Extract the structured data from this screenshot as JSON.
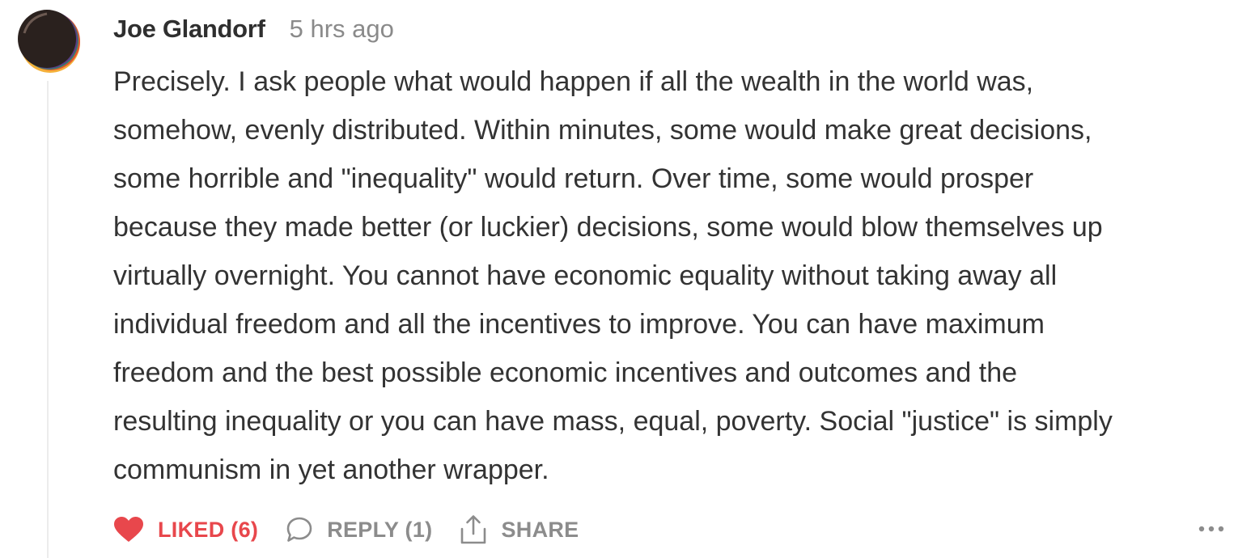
{
  "comment": {
    "author": "Joe Glandorf",
    "timestamp": "5 hrs ago",
    "body_lines": [
      "Precisely. I ask people what would happen if all the wealth in the world was,",
      "somehow, evenly distributed. Within minutes, some would make great decisions,",
      "some horrible and \"inequality\" would return. Over time, some would prosper",
      "because they made better (or luckier) decisions, some would blow themselves up",
      "virtually overnight. You cannot have economic equality without taking away all",
      "individual freedom and all the incentives to improve. You can have maximum",
      "freedom and the best possible economic incentives and outcomes and the",
      "resulting inequality or you can have mass, equal, poverty. Social \"justice\" is simply",
      "communism in yet another wrapper."
    ]
  },
  "actions": {
    "like_label": "LIKED (6)",
    "reply_label": "REPLY (1)",
    "share_label": "SHARE",
    "more_icon": "more-horizontal-icon"
  },
  "colors": {
    "liked": "#e8474c",
    "muted": "#8c8c8c",
    "text": "#333333"
  }
}
